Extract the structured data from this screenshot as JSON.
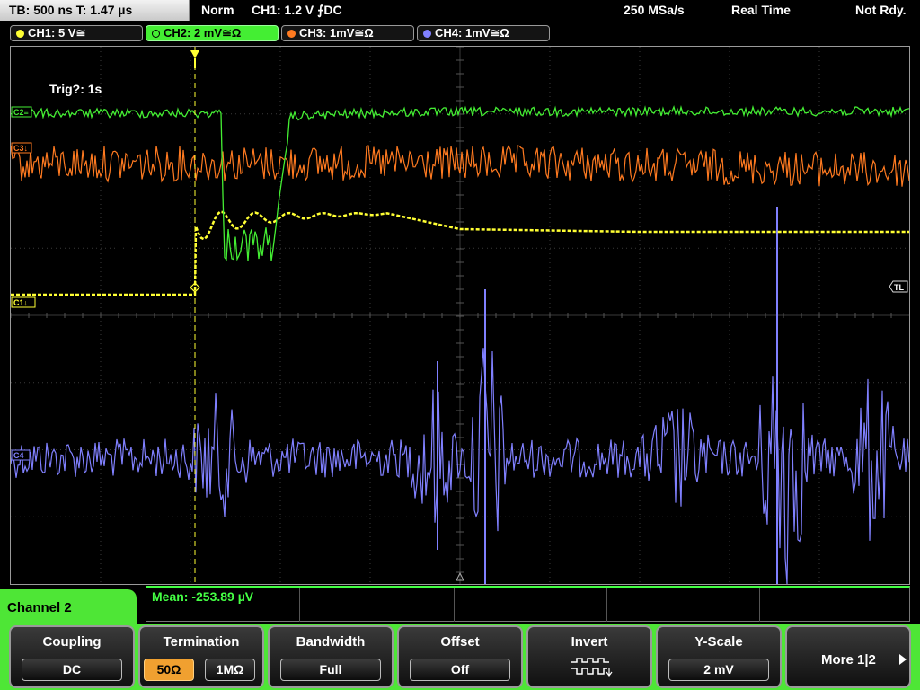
{
  "status_bar": {
    "timebase": "TB: 500 ns   T: 1.47 µs",
    "trigger_mode": "Norm",
    "trigger_setting": "CH1: 1.2 V ⨍DC",
    "sample_rate": "250 MSa/s",
    "acq_mode": "Real Time",
    "state": "Not Rdy."
  },
  "channels": [
    {
      "label": "CH1: 5 V≅",
      "color": "#ffff33"
    },
    {
      "label": "CH2: 2 mV≅Ω",
      "color": "#44ee33"
    },
    {
      "label": "CH3: 1mV≅Ω",
      "color": "#ff7a20"
    },
    {
      "label": "CH4: 1mV≅Ω",
      "color": "#8080ff"
    }
  ],
  "markers": {
    "c2": "C2≡",
    "c3": "C3↓",
    "c1": "C1↓",
    "c4": "C4",
    "tl": "TL"
  },
  "trigger_text": "Trig?: 1s",
  "measurement": "Mean: -253.89 µV",
  "panel_title": "Channel 2",
  "softkeys": {
    "coupling": {
      "title": "Coupling",
      "value": "DC"
    },
    "termination": {
      "title": "Termination",
      "opt1": "50Ω",
      "opt2": "1MΩ"
    },
    "bandwidth": {
      "title": "Bandwidth",
      "value": "Full"
    },
    "offset": {
      "title": "Offset",
      "value": "Off"
    },
    "invert": {
      "title": "Invert"
    },
    "yscale": {
      "title": "Y-Scale",
      "value": "2 mV"
    },
    "more": {
      "label": "More 1|2"
    }
  },
  "colors": {
    "ch1": "#ffff33",
    "ch2": "#44ee33",
    "ch3": "#ff7a20",
    "ch4": "#8080ff",
    "panel": "#4ee636",
    "active_option": "#f0a030"
  }
}
